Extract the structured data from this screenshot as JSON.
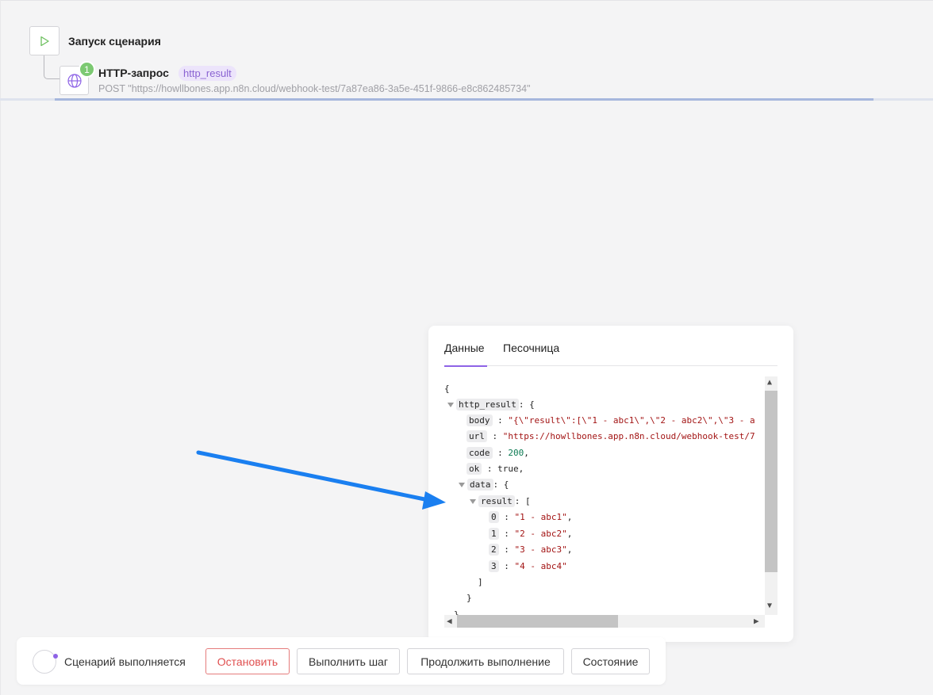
{
  "scenario": {
    "start_title": "Запуск сценария",
    "http_step": {
      "badge": "1",
      "title": "HTTP-запрос",
      "var_tag": "http_result",
      "subtitle": "POST \"https://howllbones.app.n8n.cloud/webhook-test/7a87ea86-3a5e-451f-9866-e8c862485734\""
    },
    "progress": 0.88
  },
  "panel": {
    "tabs": [
      {
        "label": "Данные",
        "active": true
      },
      {
        "label": "Песочница",
        "active": false
      }
    ],
    "json": {
      "open_brace": "{",
      "root_key": "http_result",
      "root_sep": ": {",
      "body_key": "body",
      "body_val": "\"{\\\"result\\\":[\\\"1 - abc1\\\",\\\"2 - abc2\\\",\\\"3 - a",
      "url_key": "url",
      "url_val": "\"https://howllbones.app.n8n.cloud/webhook-test/7",
      "code_key": "code",
      "code_val": "200",
      "ok_key": "ok",
      "ok_val": "true",
      "data_key": "data",
      "data_sep": ": {",
      "result_key": "result",
      "result_sep": ": [",
      "items": [
        {
          "idx": "0",
          "val": "\"1 - abc1\"",
          "comma": ","
        },
        {
          "idx": "1",
          "val": "\"2 - abc2\"",
          "comma": ","
        },
        {
          "idx": "2",
          "val": "\"3 - abc3\"",
          "comma": ","
        },
        {
          "idx": "3",
          "val": "\"4 - abc4\"",
          "comma": ""
        }
      ],
      "close_bracket": "]",
      "close_brace": "}",
      "close_root": "}"
    }
  },
  "footer": {
    "status": "Сценарий выполняется",
    "buttons": {
      "stop": "Остановить",
      "step": "Выполнить шаг",
      "continue": "Продолжить выполнение",
      "state": "Состояние"
    }
  },
  "colors": {
    "accent": "#8e63e6",
    "badge": "#7cc972",
    "annotation_arrow": "#1a7ff0",
    "stop": "#e05050"
  },
  "icons": [
    "play-icon",
    "globe-icon",
    "scroll-up-icon",
    "scroll-down-icon",
    "scroll-left-icon",
    "scroll-right-icon"
  ]
}
